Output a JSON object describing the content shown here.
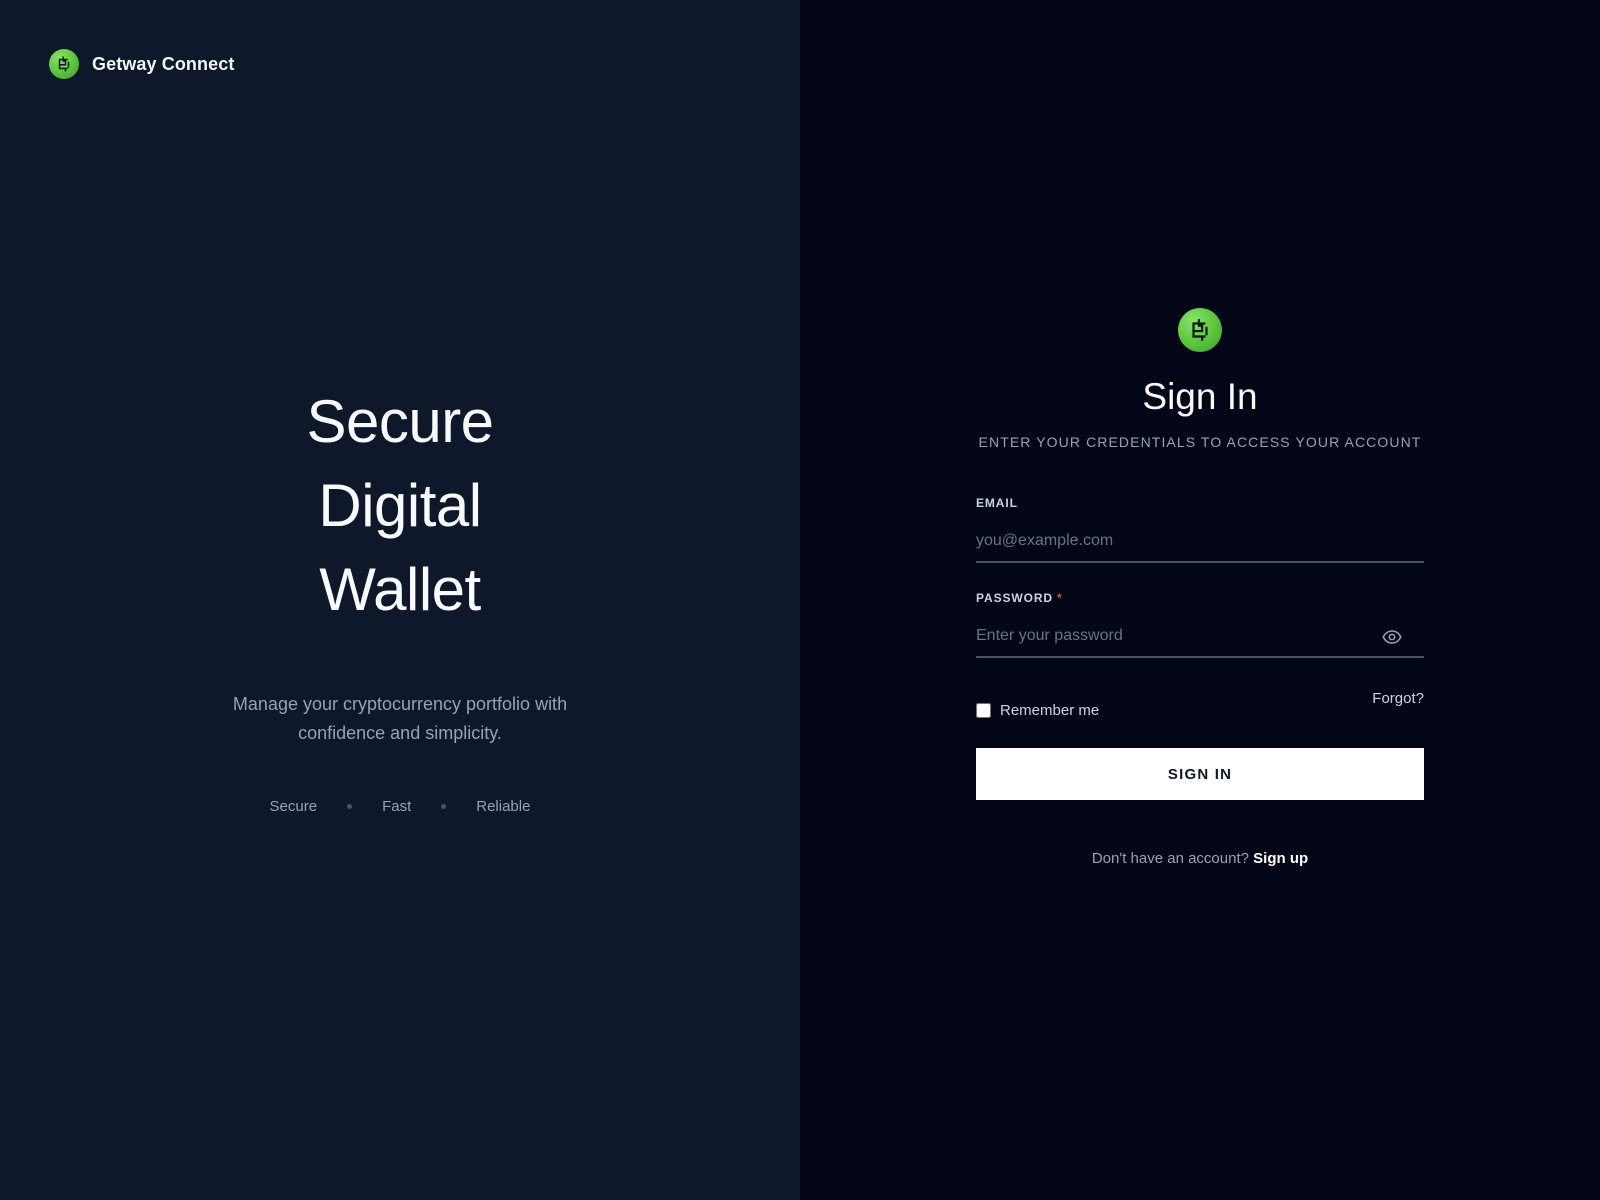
{
  "brand": {
    "name": "Getway Connect",
    "logo_icon": "getway-coin-icon",
    "logo_color": "#5cc83e"
  },
  "hero": {
    "lines": [
      "Secure",
      "Digital",
      "Wallet"
    ],
    "subtitle": "Manage your cryptocurrency portfolio with confidence and simplicity.",
    "tags": [
      "Secure",
      "Fast",
      "Reliable"
    ]
  },
  "form": {
    "title": "Sign In",
    "subtitle": "ENTER YOUR CREDENTIALS TO ACCESS YOUR ACCOUNT",
    "email": {
      "label": "EMAIL",
      "placeholder": "you@example.com",
      "value": ""
    },
    "password": {
      "label": "PASSWORD",
      "required_marker": "*",
      "placeholder": "Enter your password",
      "value": "",
      "toggle_icon": "eye-icon"
    },
    "remember_label": "Remember me",
    "remember_checked": false,
    "forgot_label": "Forgot?",
    "submit_label": "SIGN IN",
    "signup_prompt": "Don't have an account?",
    "signup_link": "Sign up"
  },
  "colors": {
    "left_bg": "#0f172a",
    "right_bg": "#020617",
    "accent": "#5cc83e",
    "required": "#ef4444",
    "button_bg": "#ffffff"
  }
}
